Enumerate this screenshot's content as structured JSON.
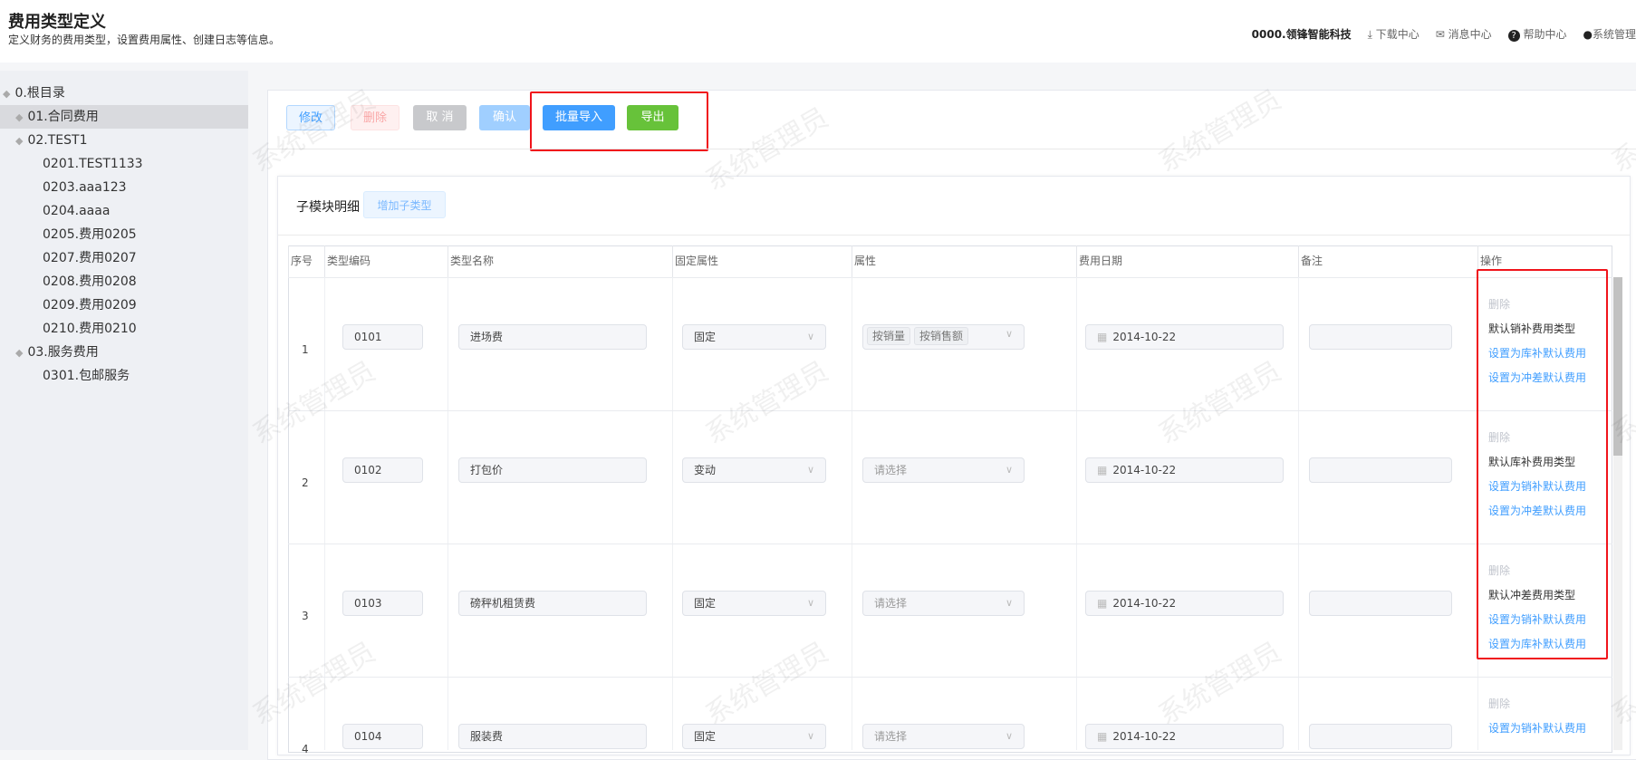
{
  "header": {
    "title": "费用类型定义",
    "subtitle": "定义财务的费用类型，设置费用属性、创建日志等信息。",
    "company": "0000.领锋智能科技",
    "download": "下载中心",
    "messages": "消息中心",
    "help": "帮助中心",
    "user": "系统管理"
  },
  "sidebar": {
    "items": [
      {
        "label": "0.根目录",
        "level": 0,
        "icon": true
      },
      {
        "label": "01.合同费用",
        "level": 1,
        "icon": true,
        "selected": true
      },
      {
        "label": "02.TEST1",
        "level": 1,
        "icon": true
      },
      {
        "label": "0201.TEST1133",
        "level": 2
      },
      {
        "label": "0203.aaa123",
        "level": 2
      },
      {
        "label": "0204.aaaa",
        "level": 2
      },
      {
        "label": "0205.费用0205",
        "level": 2
      },
      {
        "label": "0207.费用0207",
        "level": 2
      },
      {
        "label": "0208.费用0208",
        "level": 2
      },
      {
        "label": "0209.费用0209",
        "level": 2
      },
      {
        "label": "0210.费用0210",
        "level": 2
      },
      {
        "label": "03.服务费用",
        "level": 1,
        "icon": true
      },
      {
        "label": "0301.包邮服务",
        "level": 2
      }
    ]
  },
  "toolbar": {
    "edit": "修改",
    "delete": "删除",
    "cancel": "取 消",
    "confirm": "确认",
    "batch_import": "批量导入",
    "export": "导出"
  },
  "submodule": {
    "title": "子模块明细",
    "add": "增加子类型"
  },
  "table": {
    "headers": [
      "序号",
      "类型编码",
      "类型名称",
      "固定属性",
      "属性",
      "费用日期",
      "备注",
      "操作"
    ],
    "placeholder": "请选择",
    "rows": [
      {
        "index": "1",
        "code": "0101",
        "name": "进场费",
        "fixed": "固定",
        "attrs": [
          "按销量",
          "按销售额"
        ],
        "date": "2014-10-22",
        "remark": "",
        "actions": {
          "delete": "删除",
          "label": "默认销补费用类型",
          "links": [
            "设置为库补默认费用",
            "设置为冲差默认费用"
          ]
        }
      },
      {
        "index": "2",
        "code": "0102",
        "name": "打包价",
        "fixed": "变动",
        "attrs": [],
        "date": "2014-10-22",
        "remark": "",
        "actions": {
          "delete": "删除",
          "label": "默认库补费用类型",
          "links": [
            "设置为销补默认费用",
            "设置为冲差默认费用"
          ]
        }
      },
      {
        "index": "3",
        "code": "0103",
        "name": "磅秤机租赁费",
        "fixed": "固定",
        "attrs": [],
        "date": "2014-10-22",
        "remark": "",
        "actions": {
          "delete": "删除",
          "label": "默认冲差费用类型",
          "links": [
            "设置为销补默认费用",
            "设置为库补默认费用"
          ]
        }
      },
      {
        "index": "4",
        "code": "0104",
        "name": "服装费",
        "fixed": "固定",
        "attrs": [],
        "date": "2014-10-22",
        "remark": "",
        "actions": {
          "delete": "删除",
          "label": null,
          "links": [
            "设置为销补默认费用"
          ]
        }
      }
    ]
  },
  "watermark": "系统管理员",
  "colors": {
    "primary": "#409eff",
    "success": "#67c23a",
    "highlight": "#f0141b"
  }
}
